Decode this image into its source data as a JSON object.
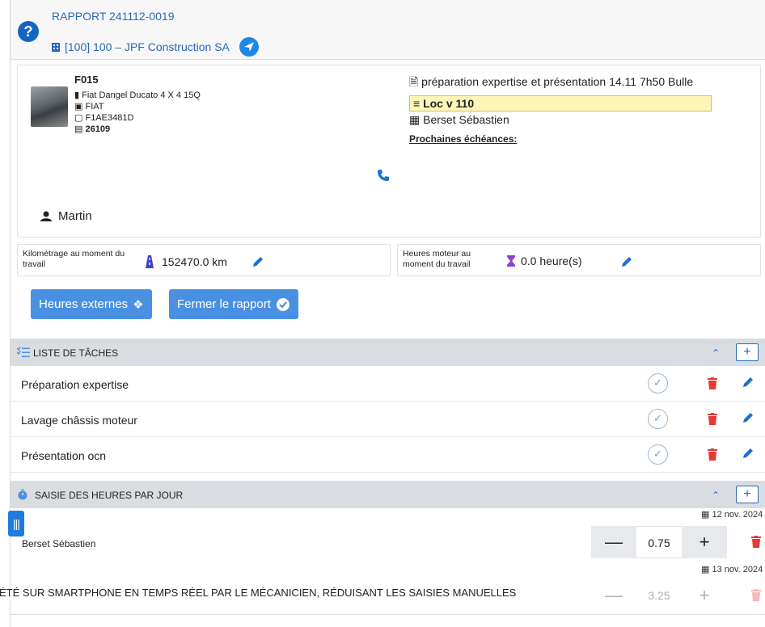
{
  "header": {
    "rapport": "RAPPORT 241112-0019",
    "client": "[100] 100 – JPF Construction SA"
  },
  "vehicle": {
    "code": "F015",
    "model": "Fiat Dangel Ducato 4 X 4 15Q",
    "brand": "FIAT",
    "plate": "F1AE3481D",
    "number": "26109"
  },
  "job": {
    "title": "préparation expertise et présentation 14.11 7h50 Bulle",
    "loc": "Loc v 110",
    "person": "Berset Sébastien",
    "next_label": "Prochaines échéances:"
  },
  "mechanic": "Martin",
  "meters": {
    "km_label": "Kilométrage au moment du travail",
    "km_value": "152470.0 km",
    "hours_label": "Heures moteur au moment du travail",
    "hours_value": "0.0 heure(s)"
  },
  "buttons": {
    "external_hours": "Heures externes",
    "close_report": "Fermer le rapport"
  },
  "tasks_section": {
    "title": "LISTE DE TÂCHES",
    "items": [
      {
        "label": "Préparation expertise"
      },
      {
        "label": "Lavage châssis moteur"
      },
      {
        "label": "Présentation ocn"
      }
    ]
  },
  "hours_section": {
    "title": "SAISIE DES HEURES PAR JOUR",
    "entries": [
      {
        "date": "12 nov. 2024",
        "name": "Berset Sébastien",
        "qty": "0.75"
      },
      {
        "date": "13 nov. 2024",
        "name": "",
        "qty": "3.25"
      }
    ]
  },
  "caption": "ÉTÉ SUR SMARTPHONE EN TEMPS RÉEL PAR LE MÉCANICIEN, RÉDUISANT LES SAISIES MANUELLES",
  "colors": {
    "accent": "#2b67b8",
    "button": "#4a90e2",
    "danger": "#e53935",
    "section_bg": "#d9dde2"
  }
}
